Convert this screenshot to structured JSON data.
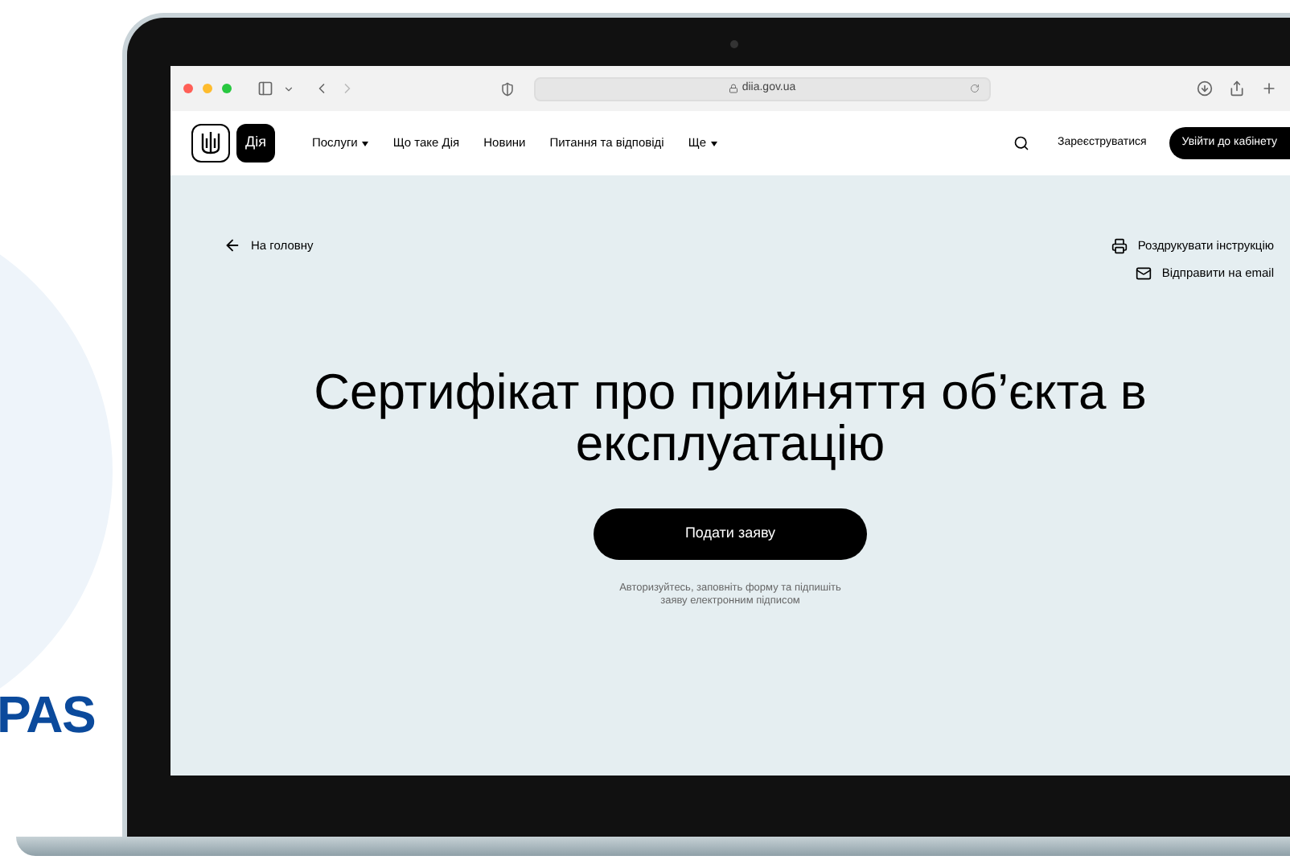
{
  "brand": {
    "text": "PAS"
  },
  "browser": {
    "url": "diia.gov.ua"
  },
  "site": {
    "logo": "Дія",
    "nav": [
      {
        "label": "Послуги",
        "dropdown": true
      },
      {
        "label": "Що таке Дія",
        "dropdown": false
      },
      {
        "label": "Новини",
        "dropdown": false
      },
      {
        "label": "Питання та відповіді",
        "dropdown": false
      },
      {
        "label": "Ще",
        "dropdown": true
      }
    ],
    "register": "Зареєструватися",
    "login": "Увійти до кабінету"
  },
  "page": {
    "back": "На головну",
    "actions": [
      {
        "kind": "print",
        "label": "Роздрукувати інструкцію"
      },
      {
        "kind": "email",
        "label": "Відправити на email"
      }
    ],
    "title": "Сертифікат про прийняття об’єкта в експлуатацію",
    "button": "Подати заяву",
    "hint": "Авторизуйтесь, заповніть форму та підпишіть заяву електронним підписом"
  }
}
